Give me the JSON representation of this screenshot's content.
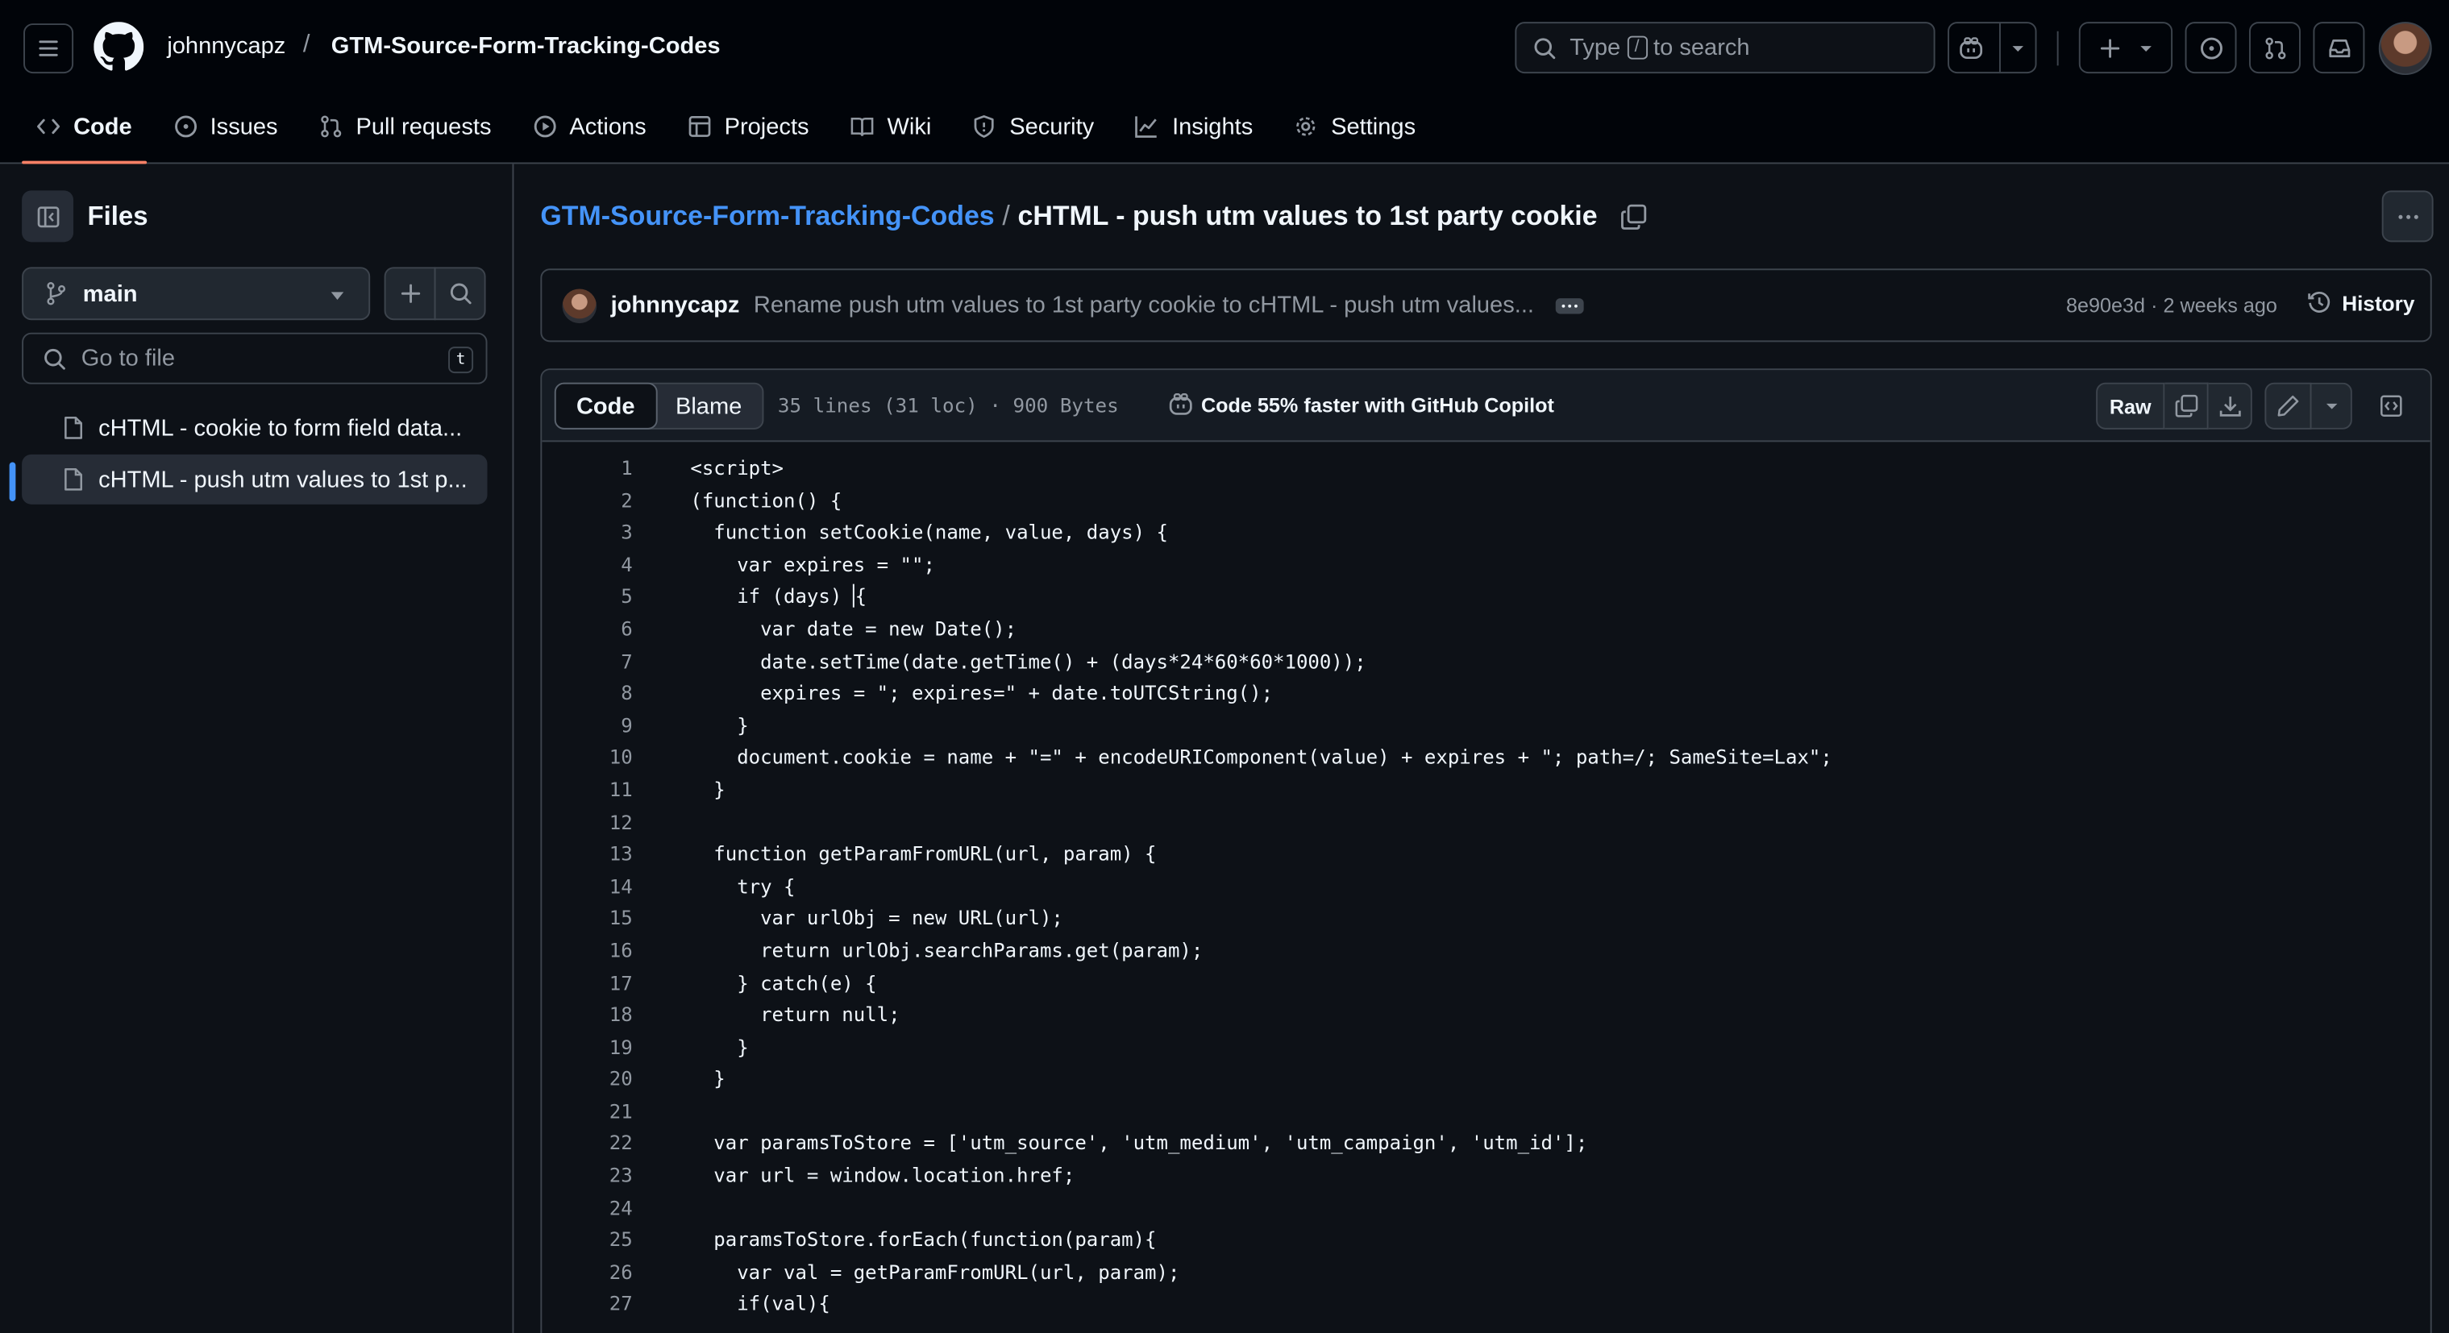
{
  "header": {
    "owner": "johnnycapz",
    "separator": "/",
    "repo": "GTM-Source-Form-Tracking-Codes",
    "search_prefix": "Type",
    "search_key": "/",
    "search_suffix": "to search"
  },
  "nav": {
    "tabs": [
      {
        "label": "Code",
        "icon": "code-icon",
        "active": true
      },
      {
        "label": "Issues",
        "icon": "issue-icon"
      },
      {
        "label": "Pull requests",
        "icon": "pull-request-icon"
      },
      {
        "label": "Actions",
        "icon": "play-icon"
      },
      {
        "label": "Projects",
        "icon": "table-icon"
      },
      {
        "label": "Wiki",
        "icon": "book-icon"
      },
      {
        "label": "Security",
        "icon": "shield-icon"
      },
      {
        "label": "Insights",
        "icon": "graph-icon"
      },
      {
        "label": "Settings",
        "icon": "gear-icon"
      }
    ]
  },
  "sidebar": {
    "title": "Files",
    "branch": "main",
    "goto_placeholder": "Go to file",
    "goto_key": "t",
    "files": [
      {
        "label": "cHTML - cookie to form field data...",
        "selected": false
      },
      {
        "label": "cHTML - push utm values to 1st p...",
        "selected": true
      }
    ]
  },
  "path": {
    "repo": "GTM-Source-Form-Tracking-Codes",
    "sep": "/",
    "file": "cHTML - push utm values to 1st party cookie"
  },
  "commit": {
    "author": "johnnycapz",
    "message": "Rename push utm values to 1st party cookie to cHTML - push utm values...",
    "meta": "8e90e3d · 2 weeks ago",
    "history": "History"
  },
  "codebox": {
    "tab_code": "Code",
    "tab_blame": "Blame",
    "stats": "35 lines (31 loc) · 900 Bytes",
    "copilot": "Code 55% faster with GitHub Copilot",
    "raw": "Raw"
  },
  "code_lines": [
    "<script>",
    "(function() {",
    "  function setCookie(name, value, days) {",
    "    var expires = \"\";",
    "    if (days) {",
    "      var date = new Date();",
    "      date.setTime(date.getTime() + (days*24*60*60*1000));",
    "      expires = \"; expires=\" + date.toUTCString();",
    "    }",
    "    document.cookie = name + \"=\" + encodeURIComponent(value) + expires + \"; path=/; SameSite=Lax\";",
    "  }",
    "",
    "  function getParamFromURL(url, param) {",
    "    try {",
    "      var urlObj = new URL(url);",
    "      return urlObj.searchParams.get(param);",
    "    } catch(e) {",
    "      return null;",
    "    }",
    "  }",
    "",
    "  var paramsToStore = ['utm_source', 'utm_medium', 'utm_campaign', 'utm_id'];",
    "  var url = window.location.href;",
    "",
    "  paramsToStore.forEach(function(param){",
    "    var val = getParamFromURL(url, param);",
    "    if(val){"
  ],
  "colors": {
    "accent_link": "#4493f8",
    "active_tab_underline": "#f78166",
    "bg": "#0d1117",
    "header_bg": "#010409"
  }
}
